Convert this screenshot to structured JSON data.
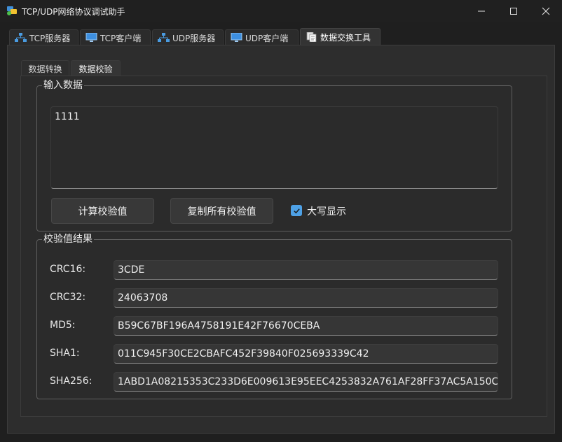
{
  "window": {
    "title": "TCP/UDP网络协议调试助手"
  },
  "tabs": [
    {
      "label": "TCP服务器",
      "icon": "network-icon"
    },
    {
      "label": "TCP客户端",
      "icon": "monitor-icon"
    },
    {
      "label": "UDP服务器",
      "icon": "network-icon"
    },
    {
      "label": "UDP客户端",
      "icon": "monitor-icon"
    },
    {
      "label": "数据交换工具",
      "icon": "documents-icon",
      "active": true
    }
  ],
  "subtabs": [
    {
      "label": "数据转换"
    },
    {
      "label": "数据校验",
      "active": true
    }
  ],
  "input_group": {
    "title": "输入数据",
    "text": "1111",
    "calc_button": "计算校验值",
    "copy_button": "复制所有校验值",
    "uppercase_label": "大写显示",
    "uppercase_checked": true
  },
  "result_group": {
    "title": "校验值结果",
    "rows": [
      {
        "label": "CRC16:",
        "value": "3CDE"
      },
      {
        "label": "CRC32:",
        "value": "24063708"
      },
      {
        "label": "MD5:",
        "value": "B59C67BF196A4758191E42F76670CEBA"
      },
      {
        "label": "SHA1:",
        "value": "011C945F30CE2CBAFC452F39840F025693339C42"
      },
      {
        "label": "SHA256:",
        "value": "1ABD1A08215353C233D6E009613E95EEC4253832A761AF28FF37AC5A150C"
      }
    ]
  },
  "colors": {
    "accent": "#4ea1e6",
    "background": "#2b2b2b"
  }
}
